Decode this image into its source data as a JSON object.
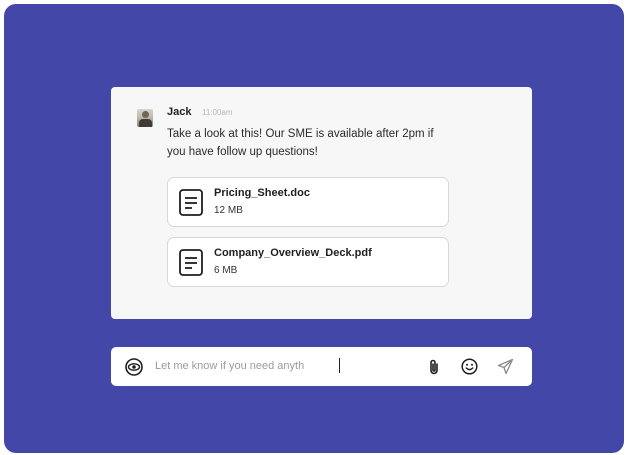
{
  "message": {
    "sender": "Jack",
    "timestamp": "11:00am",
    "text": "Take a look at this! Our SME is available after 2pm if you have follow up questions!",
    "attachments": [
      {
        "name": "Pricing_Sheet.doc",
        "size": "12 MB",
        "icon": "document-icon"
      },
      {
        "name": "Company_Overview_Deck.pdf",
        "size": "6 MB",
        "icon": "document-icon"
      }
    ]
  },
  "composer": {
    "value": "Let me know if you need anyth",
    "icons": [
      "eye-icon",
      "paperclip-icon",
      "emoji-icon",
      "send-icon"
    ]
  },
  "colors": {
    "background": "#4347a8",
    "card": "#f7f7f8",
    "composer": "#ffffff",
    "input_text": "#9a9aa3"
  }
}
